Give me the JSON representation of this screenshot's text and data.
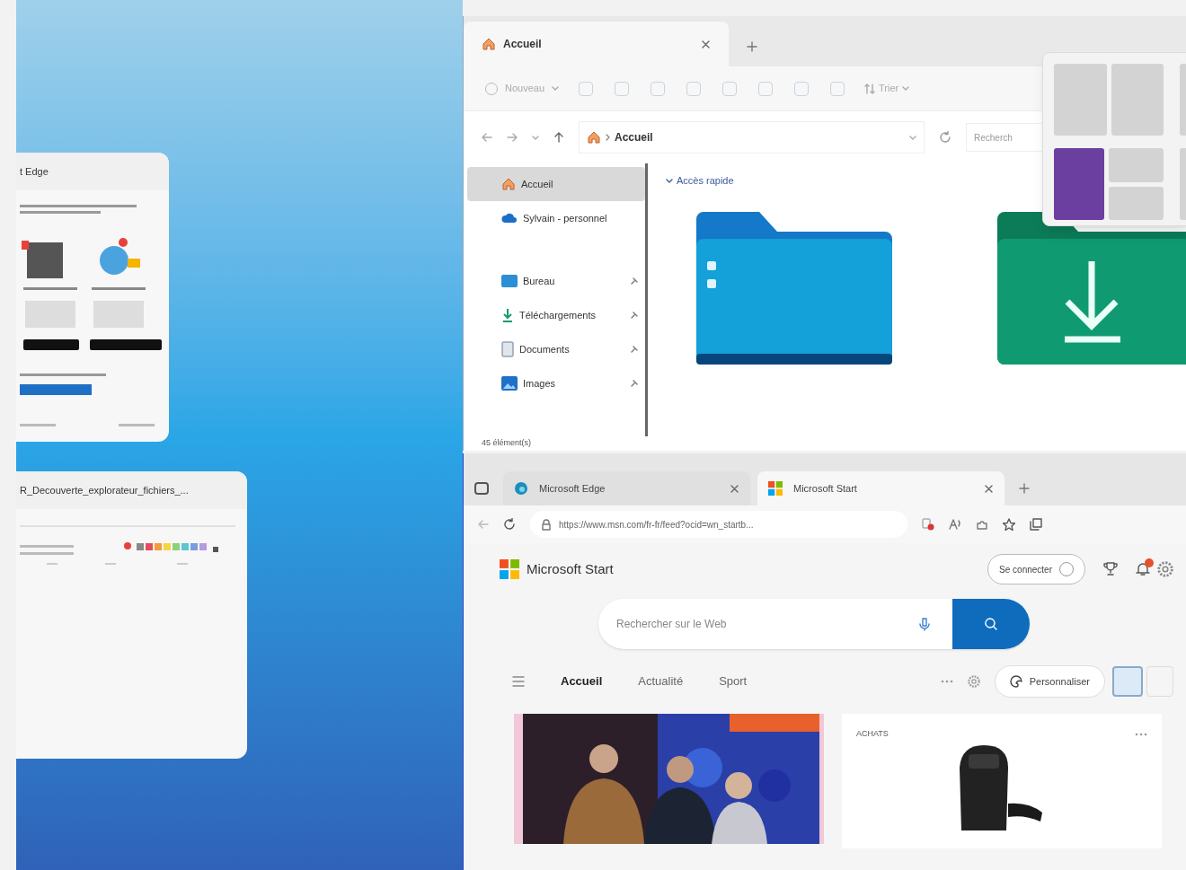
{
  "desktop": {
    "previews": [
      {
        "kind": "edge",
        "title": "t Edge"
      },
      {
        "kind": "document",
        "title": "R_Decouverte_explorateur_fichiers_..."
      }
    ]
  },
  "explorer": {
    "tab": "Accueil",
    "toolbar": {
      "new": "Nouveau",
      "sort": "Trier"
    },
    "address": "Accueil",
    "search_placeholder": "Recherch",
    "sidebar": [
      {
        "label": "Accueil",
        "selected": true
      },
      {
        "label": "Sylvain - personnel",
        "selected": false
      },
      {
        "label": "Bureau",
        "selected": false
      },
      {
        "label": "Téléchargements",
        "selected": false
      },
      {
        "label": "Documents",
        "selected": false
      },
      {
        "label": "Images",
        "selected": false
      }
    ],
    "section": "Accès rapide",
    "folders": [
      {
        "kind": "desktop"
      },
      {
        "kind": "downloads"
      }
    ],
    "status": "45 élément(s)"
  },
  "snap_layouts": [
    {
      "kind": "columns",
      "zones": [
        {
          "selected": false
        },
        {
          "selected": false
        }
      ]
    },
    {
      "kind": "columns",
      "zones": [
        {
          "selected": false
        }
      ]
    },
    {
      "kind": "main-stack",
      "zones": [
        {
          "selected": true
        },
        {
          "selected": false
        },
        {
          "selected": false
        }
      ]
    },
    {
      "kind": "columns",
      "zones": [
        {
          "selected": false
        }
      ]
    }
  ],
  "browser": {
    "tabs": [
      {
        "label": "Microsoft Edge",
        "selected": false
      },
      {
        "label": "Microsoft Start",
        "selected": true
      }
    ],
    "url": "https://www.msn.com/fr-fr/feed?ocid=wn_startb...",
    "brand": "Microsoft Start",
    "sign_in": "Se connecter",
    "search_placeholder": "Rechercher sur le Web",
    "nav": [
      {
        "label": "Accueil",
        "selected": true
      },
      {
        "label": "Actualité",
        "selected": false
      },
      {
        "label": "Sport",
        "selected": false
      }
    ],
    "customize": "Personnaliser",
    "shopping_heading": "ACHATS"
  }
}
